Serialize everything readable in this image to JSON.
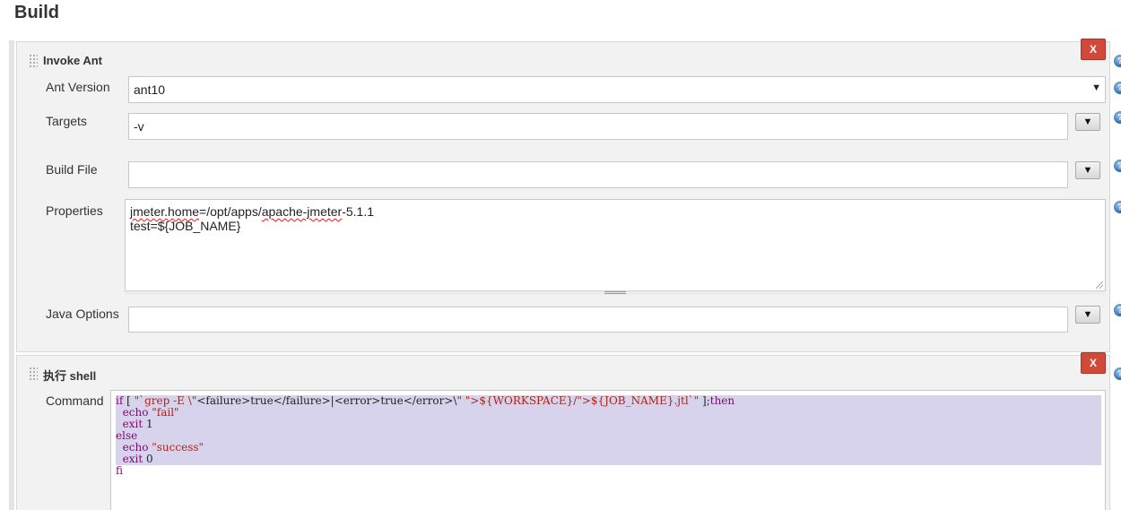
{
  "section": {
    "title": "Build"
  },
  "ant_step": {
    "title": "Invoke Ant",
    "delete_label": "X",
    "help_icon": "question-circle",
    "ant_version": {
      "label": "Ant Version",
      "value": "ant10"
    },
    "targets": {
      "label": "Targets",
      "value": "-v"
    },
    "build_file": {
      "label": "Build File",
      "value": ""
    },
    "properties": {
      "label": "Properties",
      "lines": [
        "jmeter.home=/opt/apps/apache-jmeter-5.1.1",
        "test=${JOB_NAME}"
      ]
    },
    "java_options": {
      "label": "Java Options",
      "value": ""
    }
  },
  "shell_step": {
    "title": "执行 shell",
    "delete_label": "X",
    "command_label": "Command",
    "command_lines": [
      "if [ \"`grep -E \\\"<failure>true</failure>|<error>true</error>\\\" ${WORKSPACE}/${JOB_NAME}.jtl`\" ];then",
      "  echo \"fail\"",
      "  exit 1",
      "else",
      "  echo \"success\"",
      "  exit 0",
      "fi"
    ]
  },
  "colors": {
    "delete_button": "#d24939",
    "selection": "#d8d3ec",
    "help_icon": "#2a6ab0"
  }
}
